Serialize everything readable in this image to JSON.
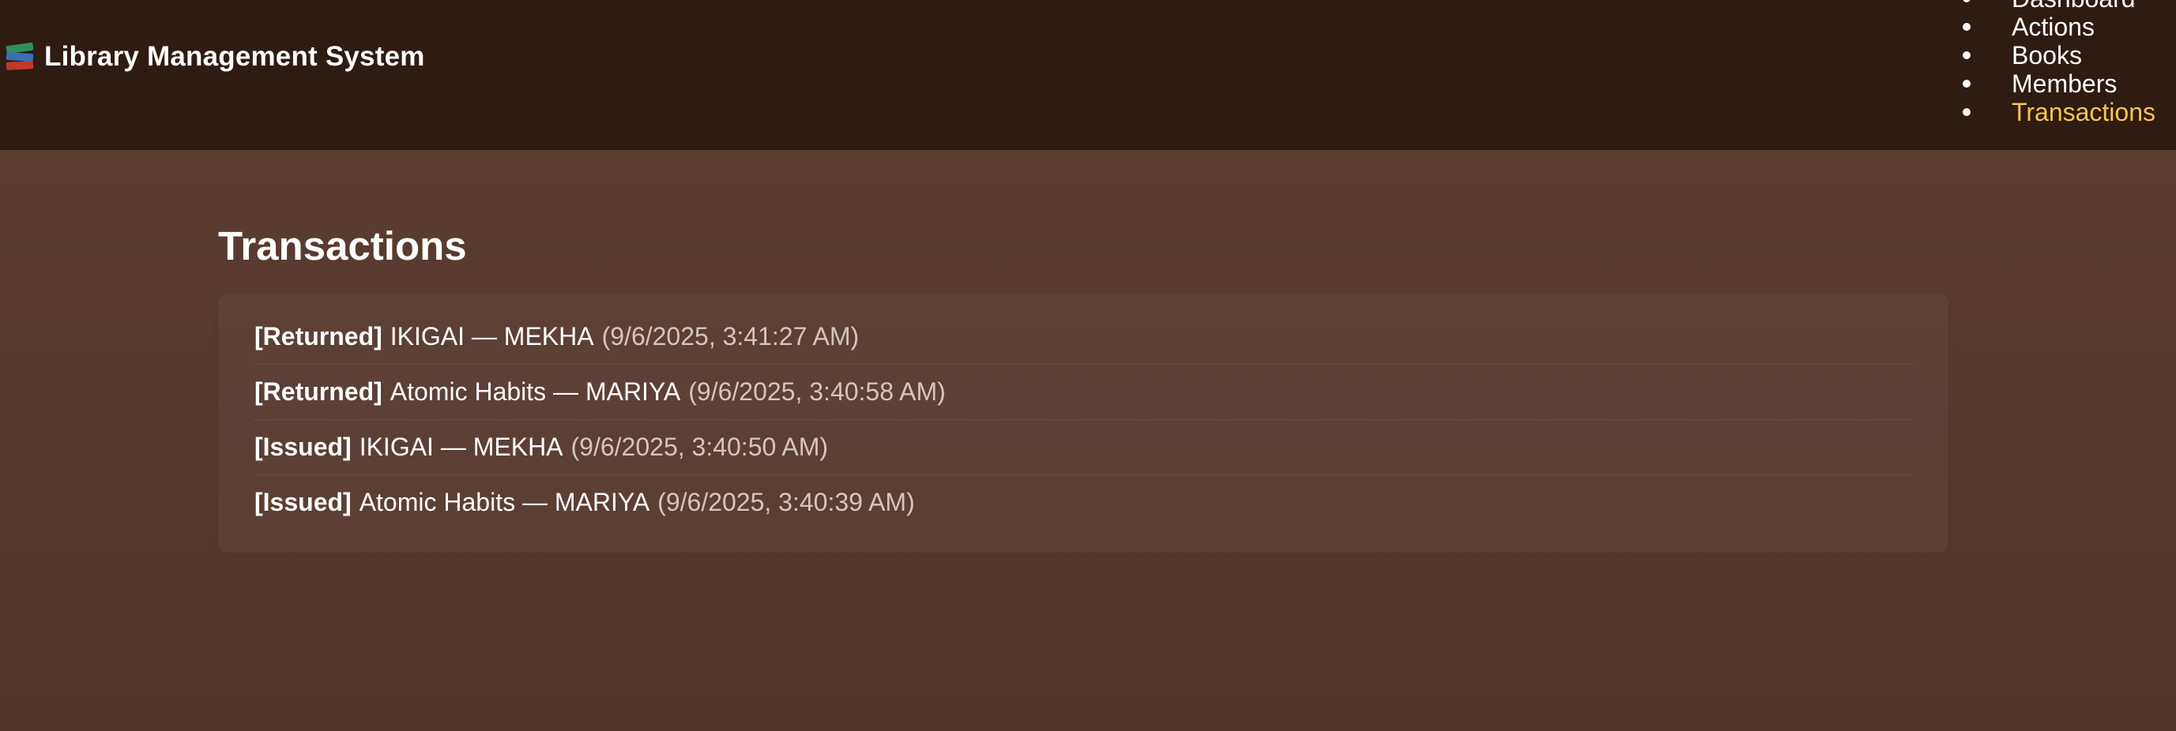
{
  "header": {
    "brand_icon": "books-icon",
    "title": "Library Management System"
  },
  "nav": {
    "items": [
      {
        "label": "Dashboard",
        "active": false
      },
      {
        "label": "Actions",
        "active": false
      },
      {
        "label": "Books",
        "active": false
      },
      {
        "label": "Members",
        "active": false
      },
      {
        "label": "Transactions",
        "active": true
      }
    ],
    "active_color": "#f6c453"
  },
  "main": {
    "title": "Transactions",
    "transactions": [
      {
        "status": "[Returned]",
        "desc": "IKIGAI — MEKHA",
        "time": "(9/6/2025, 3:41:27 AM)"
      },
      {
        "status": "[Returned]",
        "desc": "Atomic Habits — MARIYA",
        "time": "(9/6/2025, 3:40:58 AM)"
      },
      {
        "status": "[Issued]",
        "desc": "IKIGAI — MEKHA",
        "time": "(9/6/2025, 3:40:50 AM)"
      },
      {
        "status": "[Issued]",
        "desc": "Atomic Habits — MARIYA",
        "time": "(9/6/2025, 3:40:39 AM)"
      }
    ]
  },
  "colors": {
    "header_bg": "#2e1b12",
    "page_bg": "#5c3d32",
    "accent": "#f6c453"
  }
}
